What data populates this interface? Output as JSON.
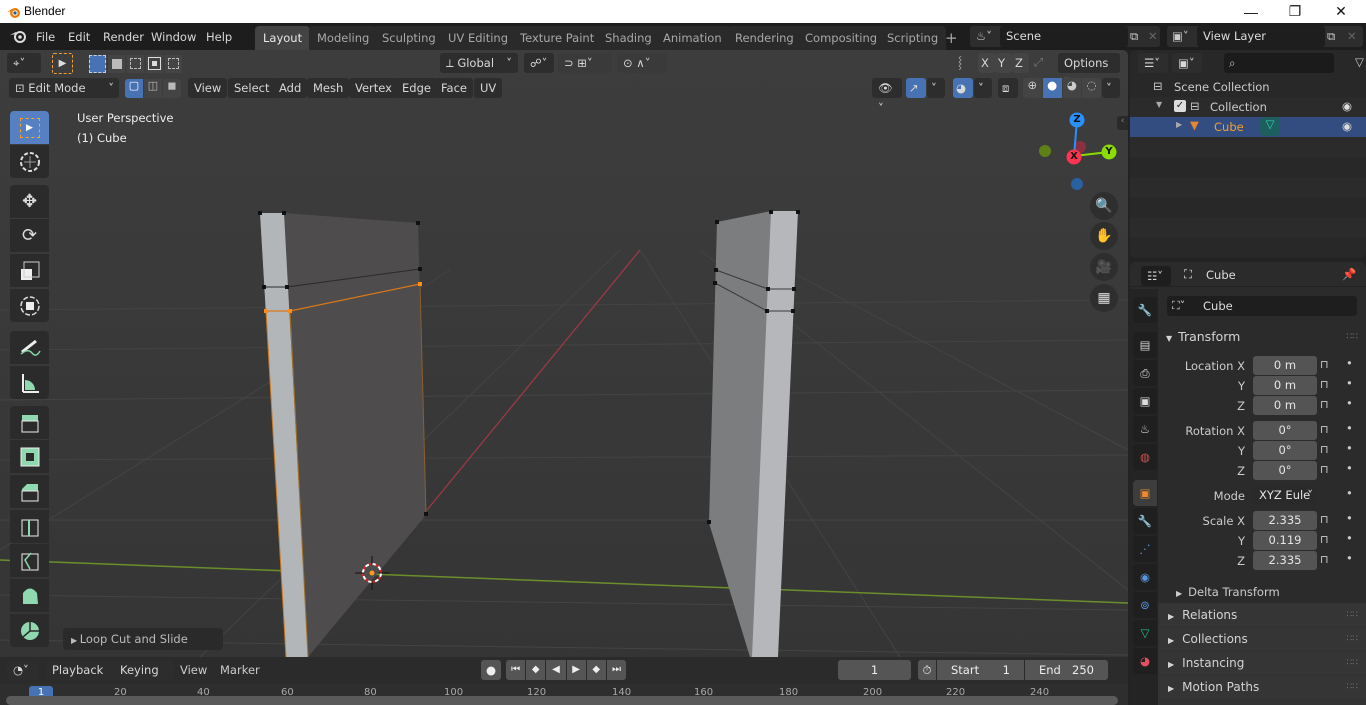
{
  "window": {
    "title": "Blender",
    "minimize": "—",
    "maximize": "❐",
    "close": "✕"
  },
  "menu": {
    "items": [
      "File",
      "Edit",
      "Render",
      "Window",
      "Help"
    ]
  },
  "workspaces": {
    "tabs": [
      "Layout",
      "Modeling",
      "Sculpting",
      "UV Editing",
      "Texture Paint",
      "Shading",
      "Animation",
      "Rendering",
      "Compositing",
      "Scripting"
    ],
    "active": "Layout",
    "add": "+"
  },
  "scene": {
    "label": "Scene",
    "view_layer": "View Layer"
  },
  "tool_header": {
    "transform_orientation": "Global",
    "axes": [
      "X",
      "Y",
      "Z"
    ],
    "options": "Options"
  },
  "viewport_header": {
    "mode": "Edit Mode",
    "menus": [
      "View",
      "Select",
      "Add",
      "Mesh",
      "Vertex",
      "Edge",
      "Face",
      "UV"
    ]
  },
  "viewport": {
    "perspective_label": "User Perspective",
    "object_label": "(1) Cube",
    "gizmo_axes": {
      "x": "X",
      "y": "Y",
      "z": "Z"
    },
    "last_operator": "Loop Cut and Slide",
    "colors": {
      "x_axis": "#ff3352",
      "y_axis": "#8bdc00",
      "z_axis": "#2890ff",
      "selection": "#ff8c1a"
    }
  },
  "toolbar": {
    "tools": [
      "select-box",
      "cursor",
      "move",
      "rotate",
      "scale",
      "transform",
      "annotate",
      "measure",
      "extrude-region",
      "inset-faces",
      "bevel",
      "loop-cut",
      "knife",
      "poly-build",
      "spin"
    ]
  },
  "outliner": {
    "search_placeholder": "",
    "items": [
      {
        "label": "Scene Collection",
        "level": 0
      },
      {
        "label": "Collection",
        "level": 1,
        "checked": true,
        "visible": true
      },
      {
        "label": "Cube",
        "level": 2,
        "selected": true,
        "visible": true
      }
    ]
  },
  "properties": {
    "header_object": "Cube",
    "name_field": "Cube",
    "transform": {
      "title": "Transform",
      "location": {
        "label": "Location X",
        "x": "0 m",
        "y": "0 m",
        "z": "0 m"
      },
      "rotation": {
        "label": "Rotation X",
        "x": "0°",
        "y": "0°",
        "z": "0°"
      },
      "mode_label": "Mode",
      "mode_value": "XYZ Eule",
      "scale": {
        "label": "Scale X",
        "x": "2.335",
        "y": "0.119",
        "z": "2.335"
      },
      "axis_y": "Y",
      "axis_z": "Z"
    },
    "delta_transform": "Delta Transform",
    "panels": [
      "Relations",
      "Collections",
      "Instancing",
      "Motion Paths"
    ]
  },
  "timeline": {
    "menus": [
      "Playback",
      "Keying",
      "View",
      "Marker"
    ],
    "current_frame": "1",
    "start_label": "Start",
    "start": "1",
    "end_label": "End",
    "end": "250",
    "ruler": [
      "1",
      "20",
      "40",
      "60",
      "80",
      "100",
      "120",
      "140",
      "160",
      "180",
      "200",
      "220",
      "240"
    ]
  }
}
